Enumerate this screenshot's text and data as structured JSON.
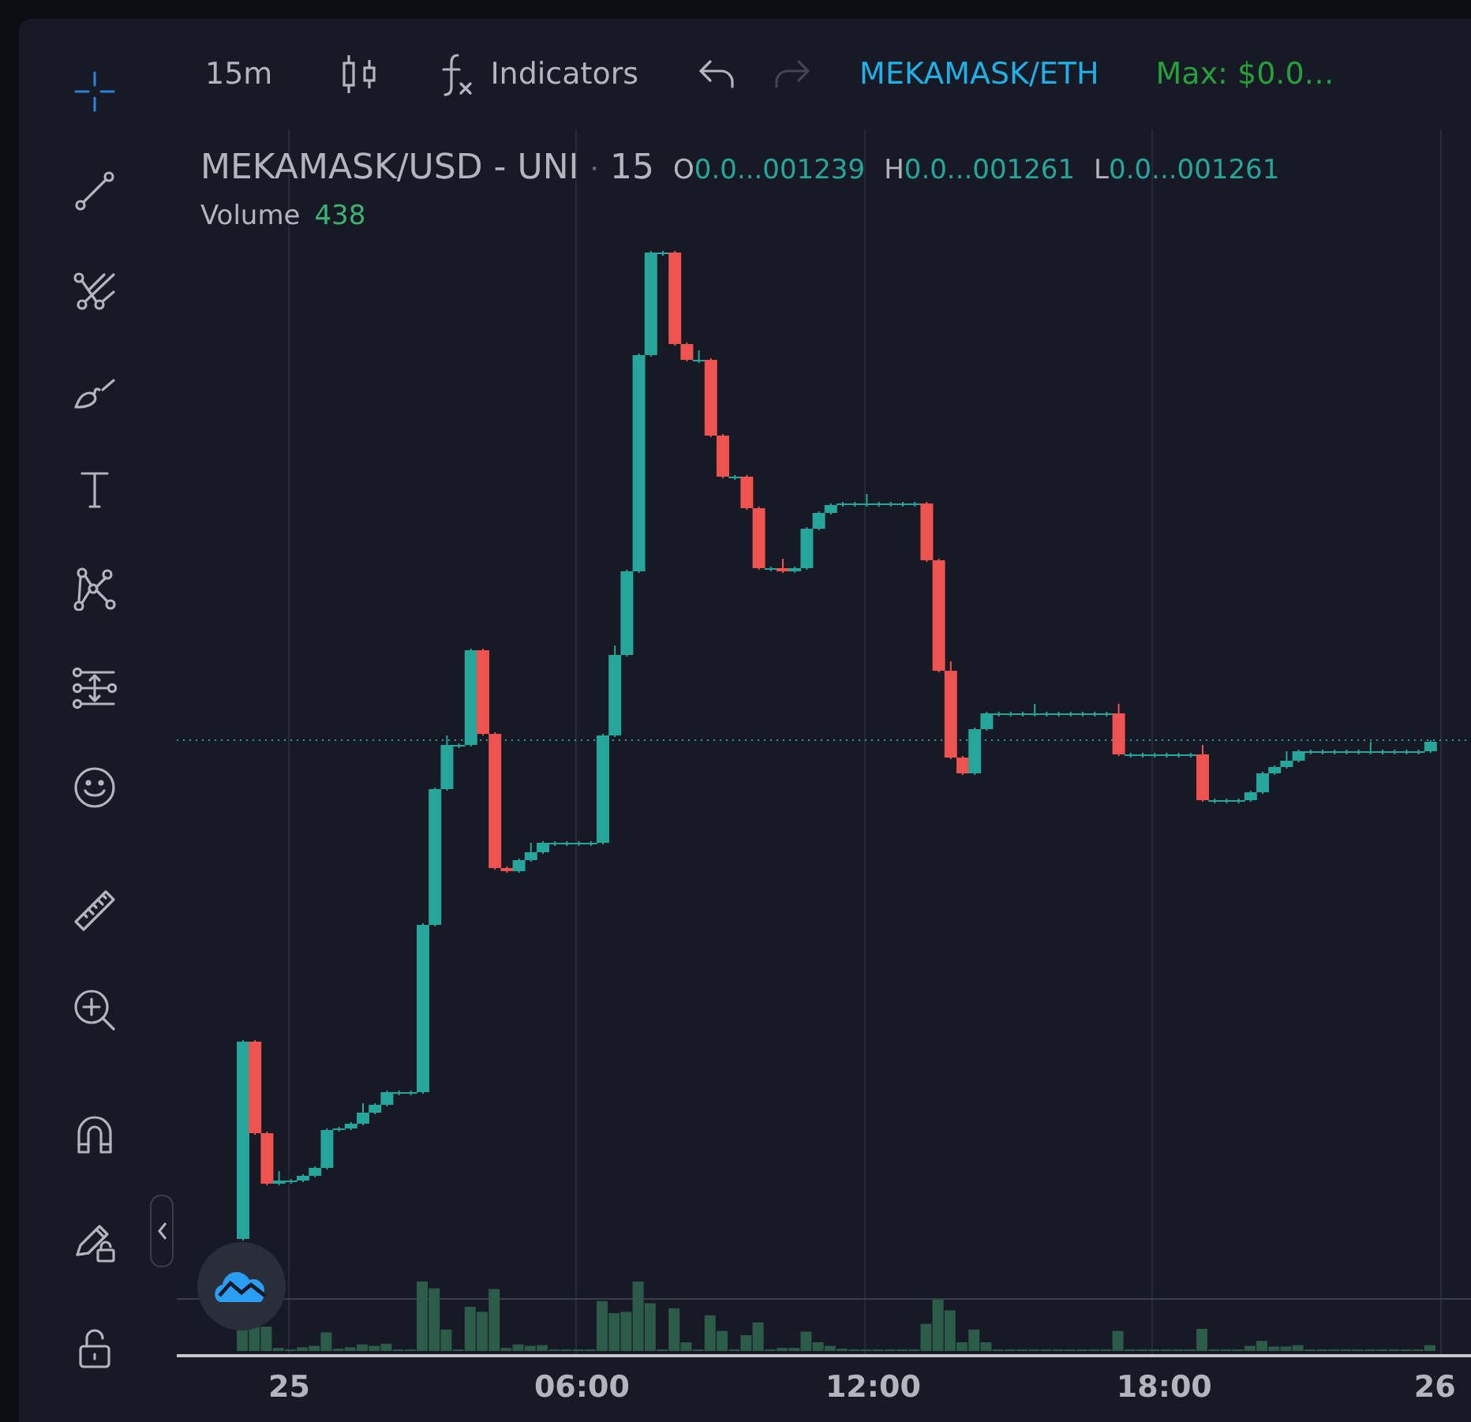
{
  "tool_groups": [
    [
      {
        "kind": "crosshair",
        "selected": true
      },
      {
        "kind": "trend-line",
        "selected": false
      },
      {
        "kind": "pitchfork",
        "selected": false
      },
      {
        "kind": "brush",
        "selected": false
      },
      {
        "kind": "text",
        "selected": false
      },
      {
        "kind": "pattern",
        "selected": false
      },
      {
        "kind": "measure-lines",
        "selected": false
      },
      {
        "kind": "emoji",
        "selected": false
      }
    ],
    [
      {
        "kind": "ruler",
        "selected": false
      },
      {
        "kind": "zoom",
        "selected": false
      }
    ],
    [
      {
        "kind": "magnet",
        "selected": false
      },
      {
        "kind": "pencil-lock",
        "selected": false
      },
      {
        "kind": "lock",
        "selected": false
      }
    ]
  ],
  "toolbar": {
    "interval": "15m",
    "indicators": "Indicators",
    "undo": {
      "disabled": false
    },
    "redo": {
      "disabled": true
    },
    "symbol": "MEKAMASK/ETH",
    "max": "Max: $0.0…"
  },
  "legend": {
    "title": "MEKAMASK/USD - UNI",
    "separator": "·",
    "interval": "15",
    "ohlc": [
      {
        "label": "O",
        "value": "0.0...001239"
      },
      {
        "label": "H",
        "value": "0.0...001261"
      },
      {
        "label": "L",
        "value": "0.0...001261"
      }
    ],
    "volume_label": "Volume",
    "volume_value": "438"
  },
  "time_axis": [
    "25",
    "06:00",
    "12:00",
    "18:00",
    "26"
  ]
}
